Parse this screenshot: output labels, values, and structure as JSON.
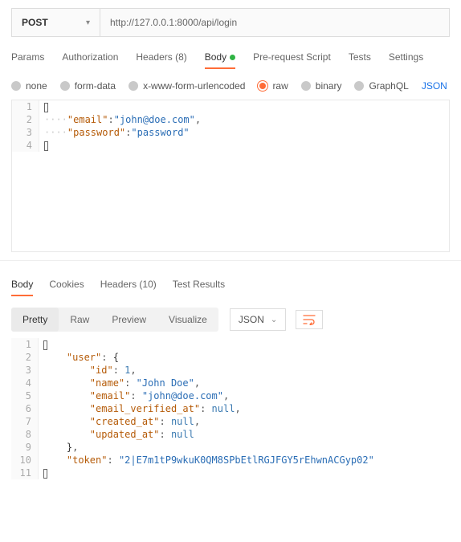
{
  "request": {
    "method": "POST",
    "url": "http://127.0.0.1:8000/api/login"
  },
  "tabs": {
    "params": "Params",
    "auth": "Authorization",
    "headers": "Headers (8)",
    "body": "Body",
    "prescript": "Pre-request Script",
    "tests": "Tests",
    "settings": "Settings"
  },
  "bodyTypes": {
    "none": "none",
    "formdata": "form-data",
    "xform": "x-www-form-urlencoded",
    "raw": "raw",
    "binary": "binary",
    "graphql": "GraphQL",
    "format": "JSON"
  },
  "reqBody": {
    "emailKey": "\"email\"",
    "emailVal": "\"john@doe.com\"",
    "passKey": "\"password\"",
    "passVal": "\"password\""
  },
  "lineNums": {
    "l1": "1",
    "l2": "2",
    "l3": "3",
    "l4": "4",
    "l5": "5",
    "l6": "6",
    "l7": "7",
    "l8": "8",
    "l9": "9",
    "l10": "10",
    "l11": "11"
  },
  "respTabs": {
    "body": "Body",
    "cookies": "Cookies",
    "headers": "Headers (10)",
    "tests": "Test Results"
  },
  "views": {
    "pretty": "Pretty",
    "raw": "Raw",
    "preview": "Preview",
    "visualize": "Visualize",
    "format": "JSON"
  },
  "respBody": {
    "userKey": "\"user\"",
    "idKey": "\"id\"",
    "idVal": "1",
    "nameKey": "\"name\"",
    "nameVal": "\"John Doe\"",
    "emailKey": "\"email\"",
    "emailVal": "\"john@doe.com\"",
    "evKey": "\"email_verified_at\"",
    "caKey": "\"created_at\"",
    "uaKey": "\"updated_at\"",
    "nullVal": "null",
    "tokenKey": "\"token\"",
    "tokenVal": "\"2|E7m1tP9wkuK0QM8SPbEtlRGJFGY5rEhwnACGyp02\""
  }
}
